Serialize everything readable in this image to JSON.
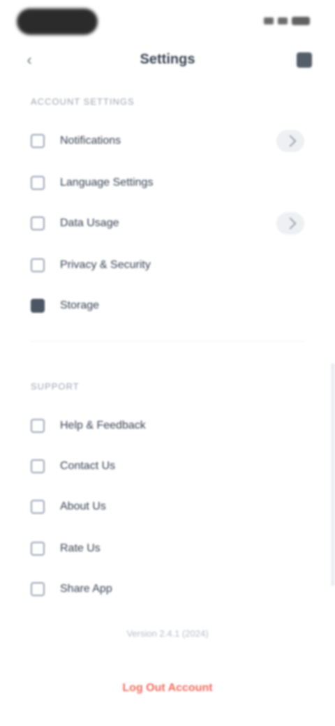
{
  "nav": {
    "title": "Settings"
  },
  "sections": [
    {
      "header": "Account Settings",
      "items": [
        {
          "label": "Notifications"
        },
        {
          "label": "Language Settings"
        },
        {
          "label": "Data Usage"
        },
        {
          "label": "Privacy & Security"
        },
        {
          "label": "Storage"
        }
      ]
    },
    {
      "header": "Support",
      "items": [
        {
          "label": "Help & Feedback"
        },
        {
          "label": "Contact Us"
        },
        {
          "label": "About Us"
        },
        {
          "label": "Rate Us"
        },
        {
          "label": "Share App"
        }
      ]
    }
  ],
  "footer": {
    "version": "Version 2.4.1 (2024)",
    "logout_label": "Log Out Account"
  },
  "colors": {
    "accent_danger": "#f26b5b",
    "text_primary": "#374151",
    "text_muted": "#9ca3af"
  }
}
